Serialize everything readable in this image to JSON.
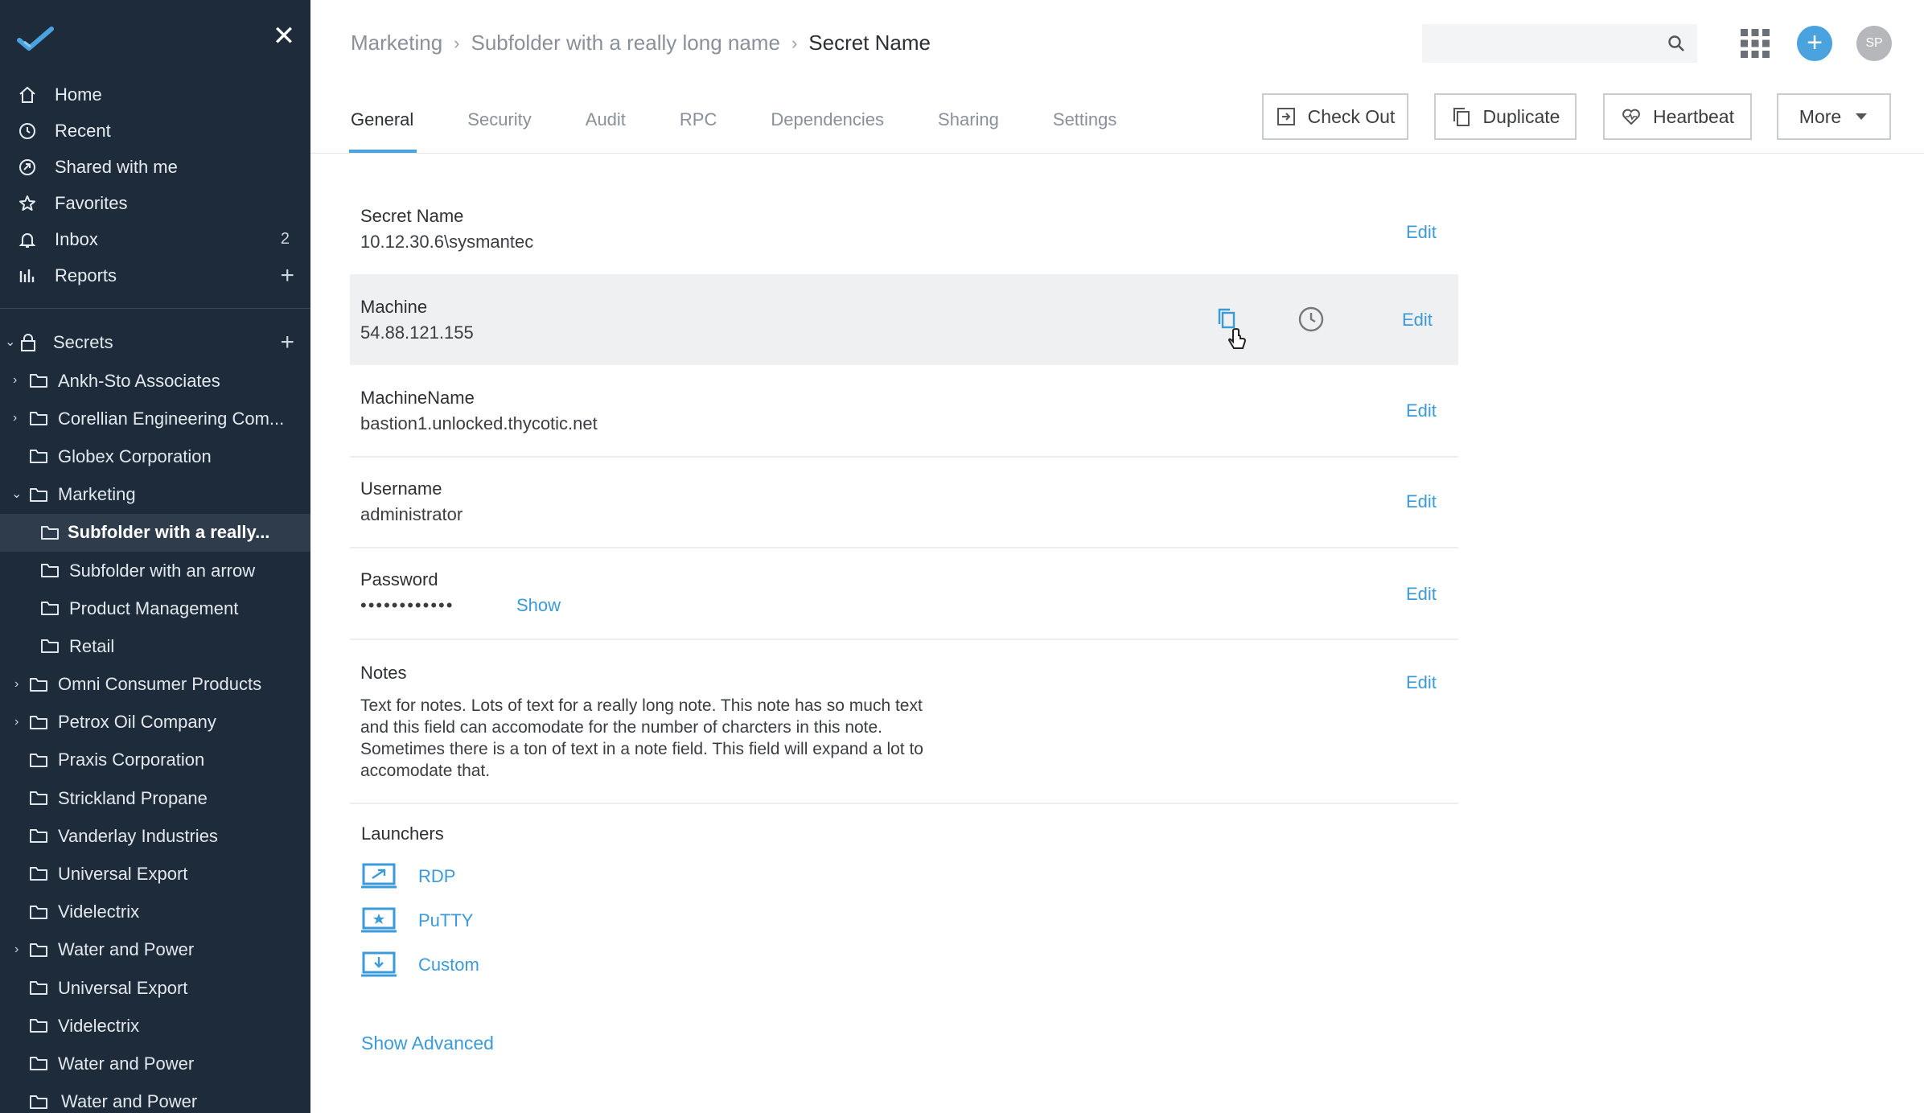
{
  "sidebar": {
    "nav": [
      {
        "label": "Home",
        "icon": "home-icon"
      },
      {
        "label": "Recent",
        "icon": "clock-icon"
      },
      {
        "label": "Shared with me",
        "icon": "shared-icon"
      },
      {
        "label": "Favorites",
        "icon": "star-icon"
      },
      {
        "label": "Inbox",
        "icon": "bell-icon",
        "count": "2"
      },
      {
        "label": "Reports",
        "icon": "bar-chart-icon",
        "plus": "+"
      }
    ],
    "secrets_label": "Secrets",
    "secrets_plus": "+",
    "tree": [
      {
        "label": "Ankh-Sto Associates",
        "chevron": "›"
      },
      {
        "label": "Corellian Engineering Com...",
        "chevron": "›"
      },
      {
        "label": "Globex Corporation",
        "chevron": ""
      },
      {
        "label": "Marketing",
        "chevron": "⌄"
      },
      {
        "label": "Subfolder with a really...",
        "chevron": ""
      },
      {
        "label": "Subfolder with an arrow",
        "chevron": ""
      },
      {
        "label": "Product Management",
        "chevron": ""
      },
      {
        "label": "Retail",
        "chevron": ""
      },
      {
        "label": "Omni Consumer Products",
        "chevron": "›"
      },
      {
        "label": "Petrox Oil Company",
        "chevron": "›"
      },
      {
        "label": "Praxis Corporation",
        "chevron": ""
      },
      {
        "label": "Strickland Propane",
        "chevron": ""
      },
      {
        "label": "Vanderlay Industries",
        "chevron": ""
      },
      {
        "label": "Universal Export",
        "chevron": ""
      },
      {
        "label": "Videlectrix",
        "chevron": ""
      },
      {
        "label": "Water and Power",
        "chevron": "›"
      },
      {
        "label": "Universal Export",
        "chevron": ""
      },
      {
        "label": "Videlectrix",
        "chevron": ""
      },
      {
        "label": "Water and Power",
        "chevron": ""
      },
      {
        "label": "Water and Power",
        "chevron": ""
      }
    ]
  },
  "header": {
    "breadcrumb": [
      "Marketing",
      "Subfolder with a really long name"
    ],
    "breadcrumb_sep": "›",
    "current": "Secret Name",
    "avatar_initials": "SP",
    "add_label": "+"
  },
  "tabs": [
    "General",
    "Security",
    "Audit",
    "RPC",
    "Dependencies",
    "Sharing",
    "Settings"
  ],
  "actions": {
    "checkout": "Check Out",
    "duplicate": "Duplicate",
    "heartbeat": "Heartbeat",
    "more": "More"
  },
  "fields": {
    "secret_name": {
      "label": "Secret Name",
      "value": "10.12.30.6\\sysmantec"
    },
    "machine": {
      "label": "Machine",
      "value": "54.88.121.155"
    },
    "machine_name": {
      "label": "MachineName",
      "value": "bastion1.unlocked.thycotic.net"
    },
    "username": {
      "label": "Username",
      "value": "administrator"
    },
    "password": {
      "label": "Password",
      "value": "••••••••••••",
      "show": "Show"
    },
    "notes": {
      "label": "Notes",
      "value": "Text for notes. Lots of text for a really long note. This note has so much text and this field can accomodate for the number of charcters in this note. Sometimes there is a ton of text in a note field. This field will expand a lot to accomodate that."
    },
    "edit_label": "Edit"
  },
  "launchers": {
    "label": "Launchers",
    "items": [
      "RDP",
      "PuTTY",
      "Custom"
    ]
  },
  "show_advanced": "Show Advanced",
  "colors": {
    "sidebar_bg": "#1d2b3a",
    "accent": "#4aa3df",
    "link": "#3b9ad8"
  }
}
